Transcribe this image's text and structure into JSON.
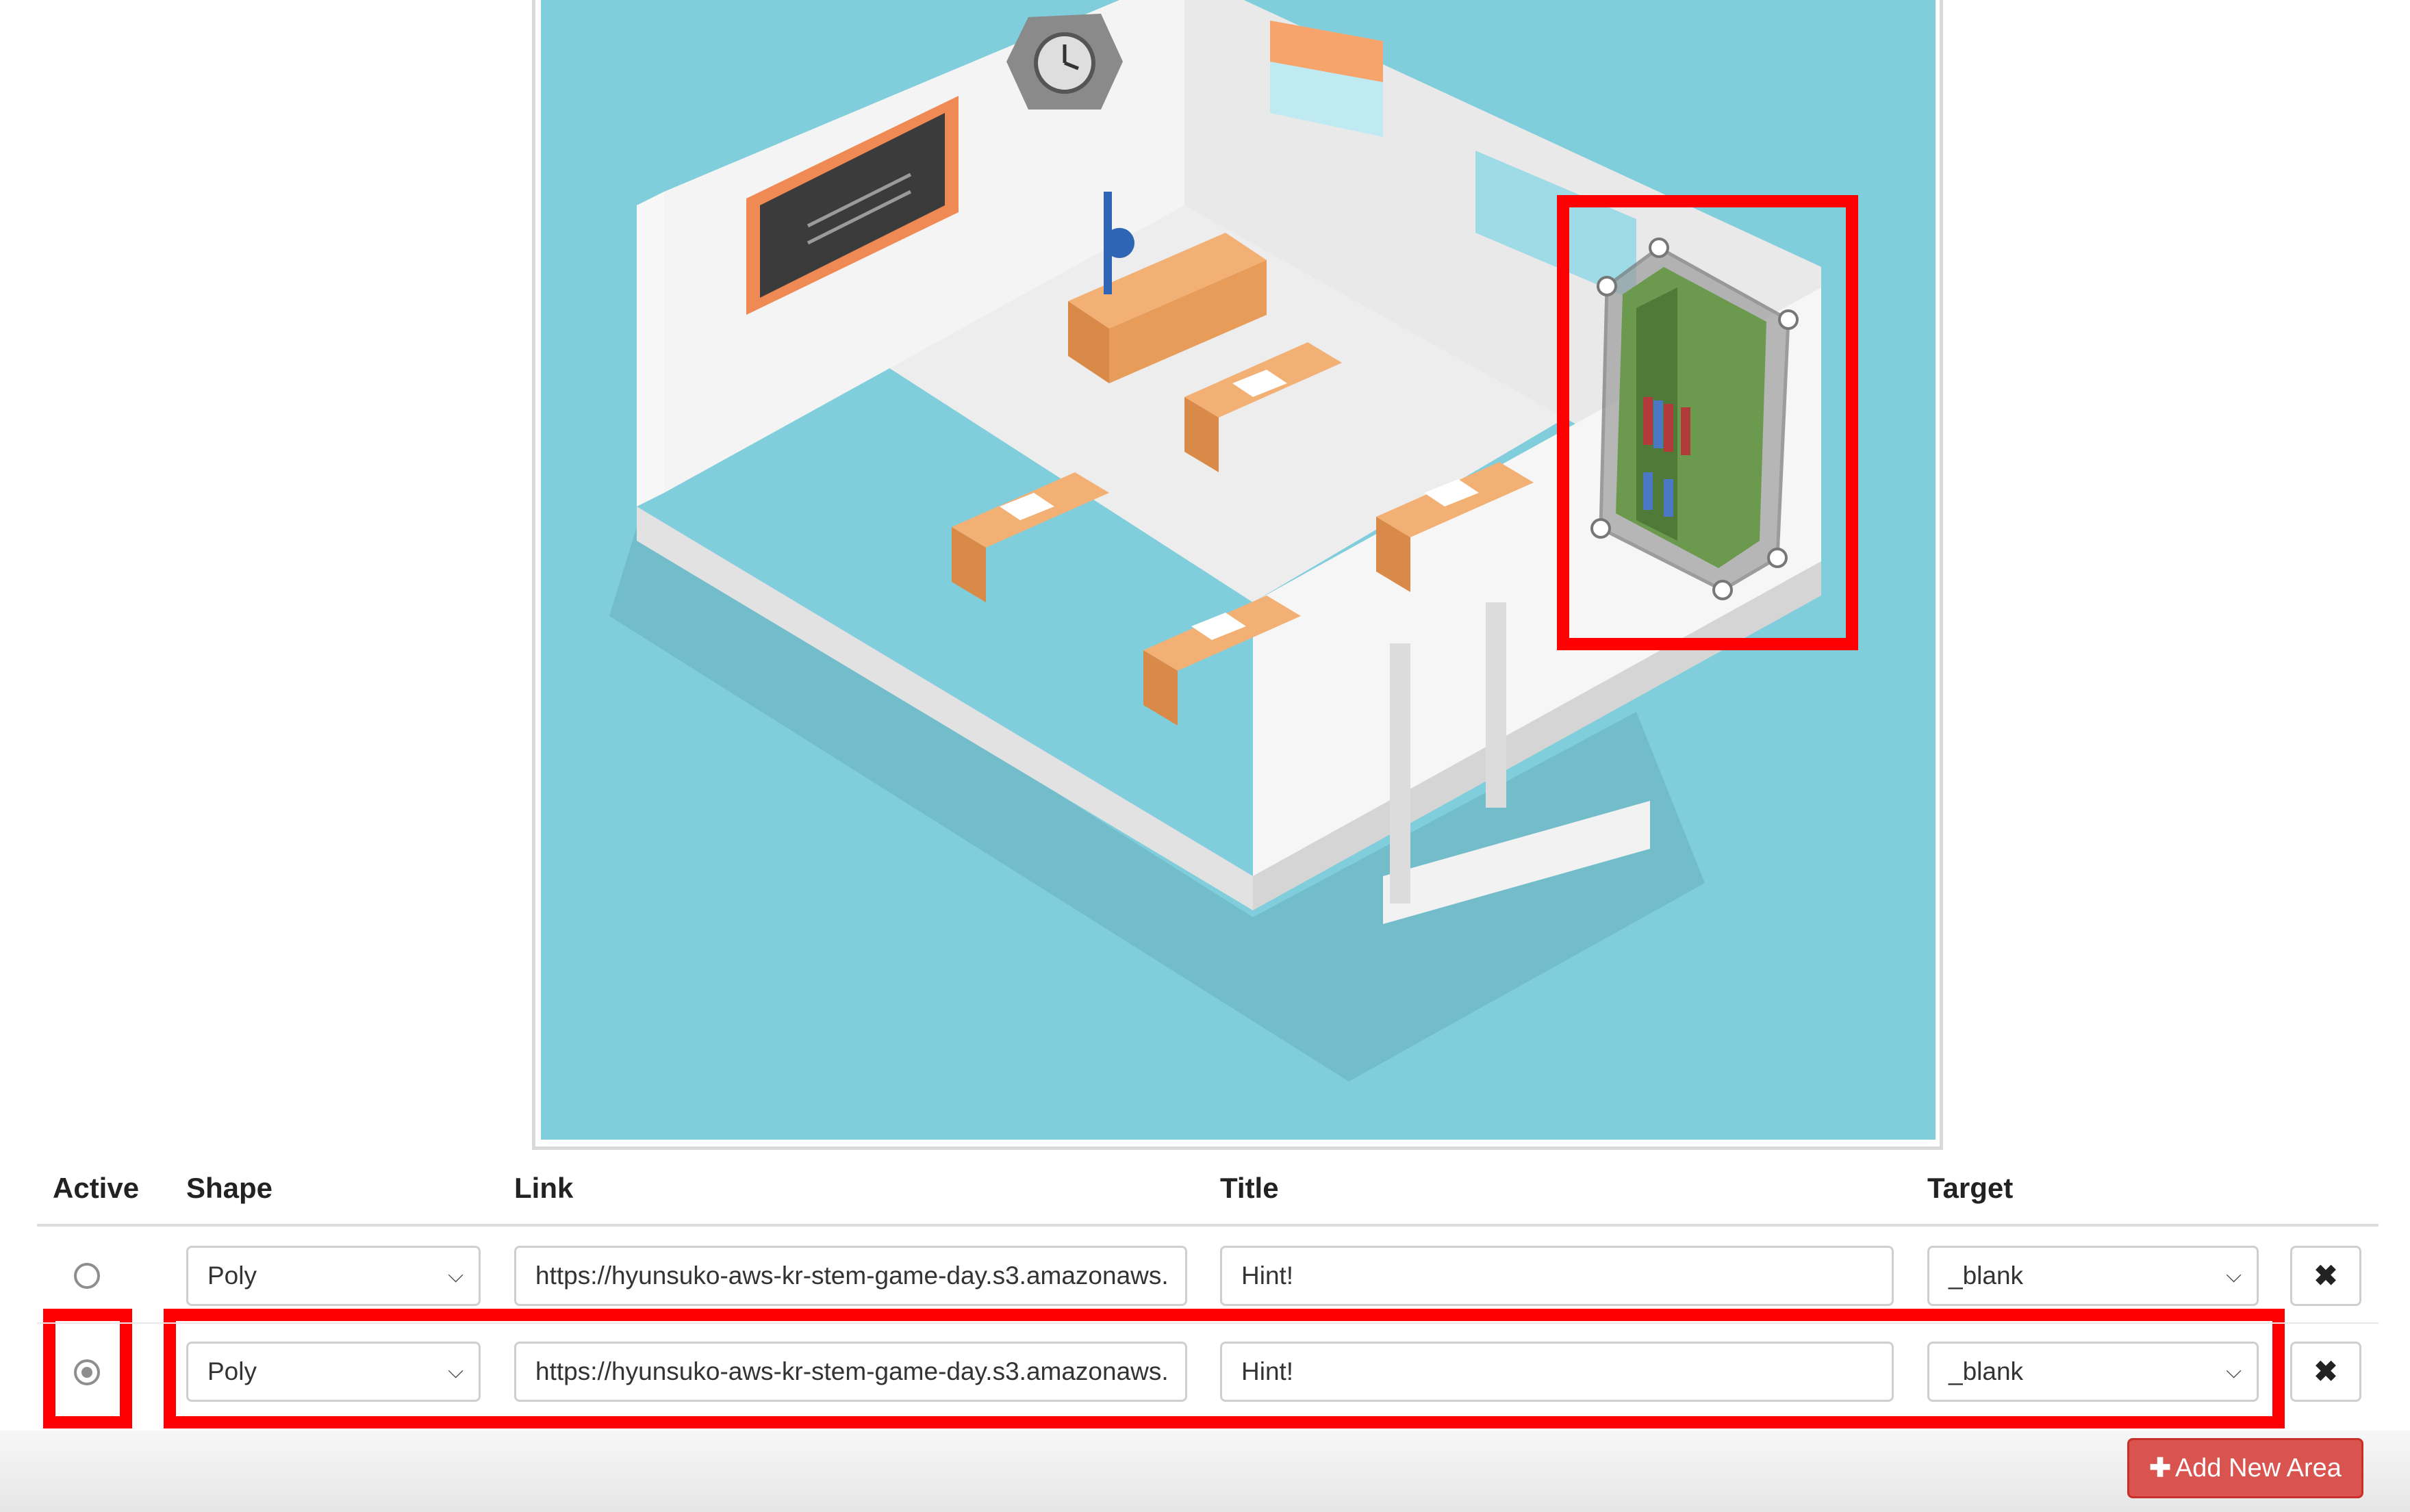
{
  "table": {
    "headers": {
      "active": "Active",
      "shape": "Shape",
      "link": "Link",
      "title": "Title",
      "target": "Target"
    },
    "rows": [
      {
        "active": false,
        "shape": "Poly",
        "link": "https://hyunsuko-aws-kr-stem-game-day.s3.amazonaws.",
        "title": "Hint!",
        "target": "_blank"
      },
      {
        "active": true,
        "shape": "Poly",
        "link": "https://hyunsuko-aws-kr-stem-game-day.s3.amazonaws.",
        "title": "Hint!",
        "target": "_blank"
      }
    ]
  },
  "actions": {
    "add_area": "Add New Area",
    "delete_icon": "✖"
  },
  "colors": {
    "accent": "#d9534f",
    "highlight": "#ff0000",
    "background": "#80cedb",
    "poly_fill": "#6b9a4e"
  },
  "icons": {
    "delete": "close-icon",
    "add": "plus-icon",
    "dropdown": "chevron-down-icon"
  }
}
